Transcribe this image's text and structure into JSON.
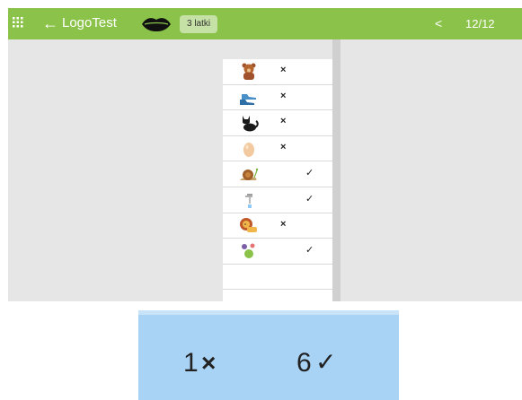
{
  "header": {
    "back_glyph": "←",
    "title": "LogoTest",
    "badge": "3 latki",
    "prev_glyph": "<",
    "page_counter": "12/12"
  },
  "list": {
    "items": [
      {
        "icon": "bear-icon",
        "mark": "×"
      },
      {
        "icon": "shoes-icon",
        "mark": "×"
      },
      {
        "icon": "cat-icon",
        "mark": "×"
      },
      {
        "icon": "egg-icon",
        "mark": "×"
      },
      {
        "icon": "snail-icon",
        "mark": "✓"
      },
      {
        "icon": "tap-icon",
        "mark": "✓"
      },
      {
        "icon": "lion-icon",
        "mark": "×"
      },
      {
        "icon": "balls-icon",
        "mark": "✓"
      }
    ]
  },
  "summary": {
    "wrong_count": "1",
    "wrong_glyph": "×",
    "right_count": "6",
    "right_glyph": "✓"
  },
  "colors": {
    "header_bg": "#8bc34a",
    "content_bg": "#e6e6e6",
    "summary_bg": "#a8d3f5"
  }
}
